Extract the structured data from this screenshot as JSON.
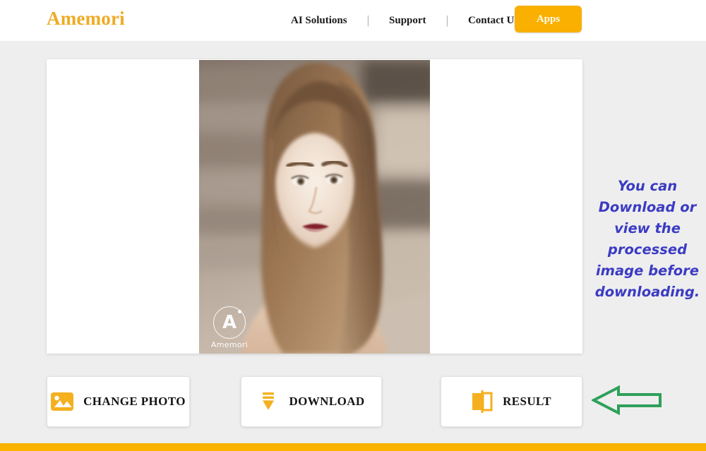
{
  "header": {
    "brand": "Amemori",
    "nav_items": [
      {
        "label": "AI Solutions"
      },
      {
        "label": "Support"
      },
      {
        "label": "Contact Us"
      }
    ],
    "separator": "|",
    "apps_button": "Apps",
    "brand_color": "#efab24",
    "accent_color": "#f9b000"
  },
  "canvas": {
    "watermark_letter": "A",
    "watermark_text": "Amemori",
    "photo_alt": "Portrait of a young woman with long brown hair and dark red lipstick in front of a blurred brick wall"
  },
  "side_note": {
    "text": "You can Download or view the processed image before downloading.",
    "color": "#3b3bc4"
  },
  "actions": [
    {
      "label": "CHANGE PHOTO",
      "icon": "image-icon"
    },
    {
      "label": "DOWNLOAD",
      "icon": "download-arrow-icon"
    },
    {
      "label": "RESULT",
      "icon": "compare-split-icon"
    }
  ],
  "annotation": {
    "arrow": "left-arrow-icon",
    "color": "#2ea05a"
  },
  "footer": {
    "bar_color": "#fbb300"
  }
}
